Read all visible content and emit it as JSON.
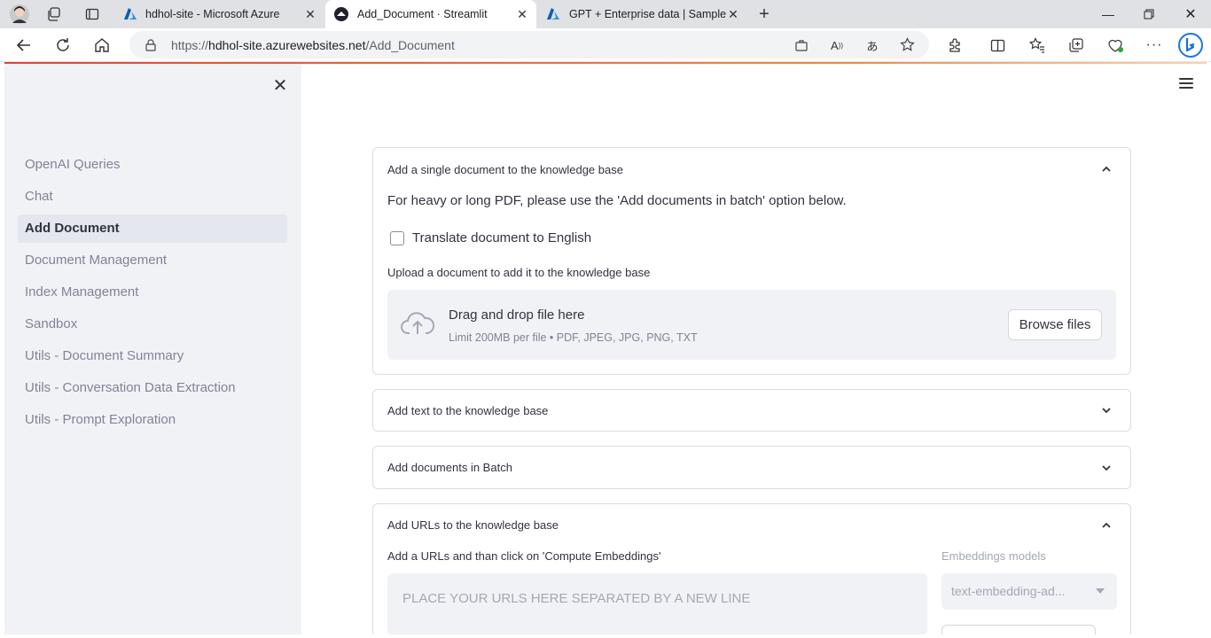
{
  "browser": {
    "tabs": [
      {
        "title": "hdhol-site - Microsoft Azure",
        "icon": "azure-icon"
      },
      {
        "title": "Add_Document · Streamlit",
        "icon": "streamlit-icon",
        "active": true
      },
      {
        "title": "GPT + Enterprise data | Sample",
        "icon": "azure-icon"
      }
    ],
    "url_prefix": "https://",
    "url_host": "hdhol-site.azurewebsites.net",
    "url_path": "/Add_Document"
  },
  "sidebar": {
    "items": [
      {
        "label": "OpenAI Queries"
      },
      {
        "label": "Chat"
      },
      {
        "label": "Add Document",
        "active": true
      },
      {
        "label": "Document Management"
      },
      {
        "label": "Index Management"
      },
      {
        "label": "Sandbox"
      },
      {
        "label": "Utils - Document Summary"
      },
      {
        "label": "Utils - Conversation Data Extraction"
      },
      {
        "label": "Utils - Prompt Exploration"
      }
    ]
  },
  "main": {
    "single_doc": {
      "title": "Add a single document to the knowledge base",
      "note": "For heavy or long PDF, please use the 'Add documents in batch' option below.",
      "translate_label": "Translate document to English",
      "upload_label": "Upload a document to add it to the knowledge base",
      "drop_title": "Drag and drop file here",
      "drop_hint": "Limit 200MB per file • PDF, JPEG, JPG, PNG, TXT",
      "browse_label": "Browse files"
    },
    "add_text": {
      "title": "Add text to the knowledge base"
    },
    "batch": {
      "title": "Add documents in Batch"
    },
    "urls": {
      "title": "Add URLs to the knowledge base",
      "instruction": "Add a URLs and than click on 'Compute Embeddings'",
      "placeholder": "PLACE YOUR URLS HERE SEPARATED BY A NEW LINE",
      "model_label": "Embeddings models",
      "model_value": "text-embedding-ad..."
    }
  },
  "colors": {
    "accent": "#ff4b4b",
    "sidebar_bg": "#f0f2f6",
    "text": "#31333f",
    "muted": "#808495"
  }
}
